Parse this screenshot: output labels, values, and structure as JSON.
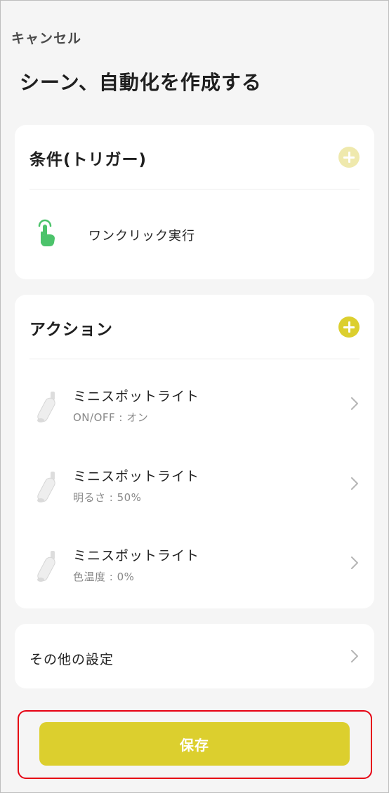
{
  "header": {
    "cancel_label": "キャンセル",
    "title": "シーン、自動化を作成する"
  },
  "conditions": {
    "title": "条件(トリガー)",
    "add_icon": "plus-circle-icon",
    "items": [
      {
        "icon": "tap-hand-icon",
        "label": "ワンクリック実行"
      }
    ]
  },
  "actions": {
    "title": "アクション",
    "add_icon": "plus-circle-icon",
    "items": [
      {
        "icon": "spotlight-icon",
        "name": "ミニスポットライト",
        "detail": "ON/OFF : オン"
      },
      {
        "icon": "spotlight-icon",
        "name": "ミニスポットライト",
        "detail": "明るさ : 50%"
      },
      {
        "icon": "spotlight-icon",
        "name": "ミニスポットライト",
        "detail": "色温度 : 0%"
      }
    ]
  },
  "other_settings": {
    "label": "その他の設定"
  },
  "save": {
    "label": "保存"
  },
  "colors": {
    "accent": "#dccf2e",
    "accent_faded": "#efe9ad",
    "highlight": "#e60012",
    "trigger_green": "#4cc36b",
    "background": "#f5f5f5",
    "card": "#ffffff"
  }
}
